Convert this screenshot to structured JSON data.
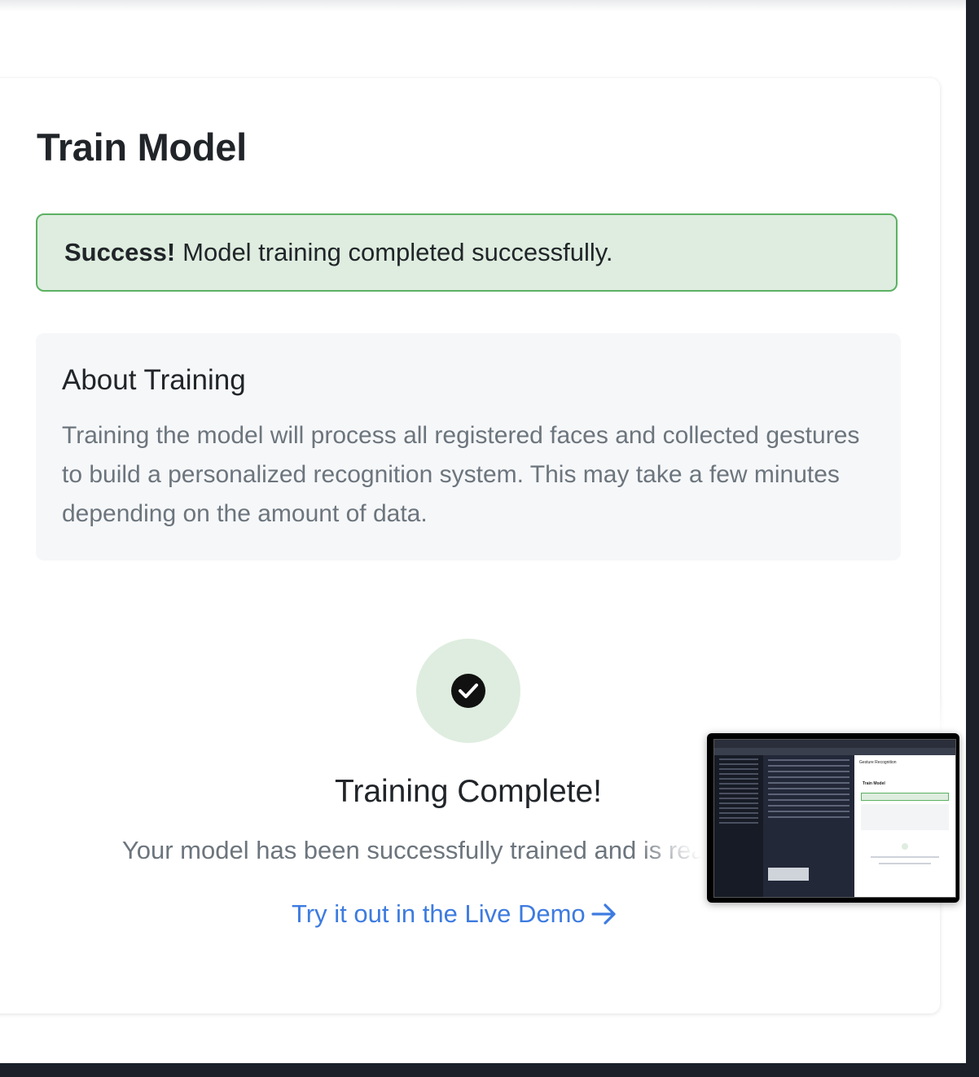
{
  "page": {
    "title": "Train Model"
  },
  "alert": {
    "strong": "Success!",
    "message": "Model training completed successfully."
  },
  "about": {
    "title": "About Training",
    "text": "Training the model will process all registered faces and collected gestures to build a personalized recognition system. This may take a few minutes depending on the amount of data."
  },
  "result": {
    "title": "Training Complete!",
    "text": "Your model has been successfully trained and is ready to use.",
    "link_label": "Try it out in the Live Demo"
  },
  "thumbnail": {
    "panel_header": "Gesture Recognition",
    "panel_title": "Train Model"
  },
  "colors": {
    "success_bg": "#deeddf",
    "success_border": "#5cb162",
    "link": "#3d7be0",
    "muted_text": "#6c757d",
    "heading_text": "#212529"
  },
  "icons": {
    "status": "check-circle-icon",
    "link": "arrow-right-icon"
  }
}
